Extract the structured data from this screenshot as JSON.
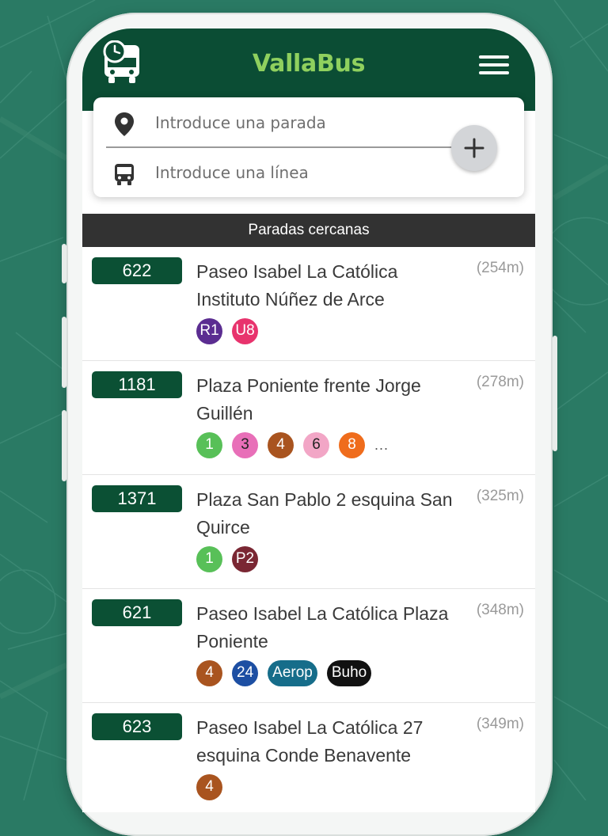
{
  "app": {
    "title": "VallaBus",
    "logo_icon": "bus-clock-icon",
    "menu_icon": "hamburger-menu-icon"
  },
  "search": {
    "stop_placeholder": "Introduce una parada",
    "stop_icon": "location-pin-icon",
    "line_placeholder": "Introduce una línea",
    "line_icon": "bus-icon",
    "add_icon": "plus-icon"
  },
  "nearby": {
    "header": "Paradas cercanas",
    "stops": [
      {
        "code": "622",
        "name": "Paseo Isabel La Católica Instituto Núñez de Arce",
        "distance": "(254m)",
        "lines": [
          {
            "label": "R1",
            "bg": "#5b2d91",
            "fg": "#ffffff"
          },
          {
            "label": "U8",
            "bg": "#e8336d",
            "fg": "#ffffff"
          }
        ],
        "more": ""
      },
      {
        "code": "1181",
        "name": "Plaza Poniente frente Jorge Guillén",
        "distance": "(278m)",
        "lines": [
          {
            "label": "1",
            "bg": "#58c058",
            "fg": "#ffffff"
          },
          {
            "label": "3",
            "bg": "#e86fb8",
            "fg": "#222222"
          },
          {
            "label": "4",
            "bg": "#a9541f",
            "fg": "#ffffff"
          },
          {
            "label": "6",
            "bg": "#f2a6c6",
            "fg": "#222222"
          },
          {
            "label": "8",
            "bg": "#ef6c1c",
            "fg": "#ffffff"
          }
        ],
        "more": "..."
      },
      {
        "code": "1371",
        "name": "Plaza San Pablo 2 esquina San Quirce",
        "distance": "(325m)",
        "lines": [
          {
            "label": "1",
            "bg": "#58c058",
            "fg": "#ffffff"
          },
          {
            "label": "P2",
            "bg": "#7a2733",
            "fg": "#ffffff"
          }
        ],
        "more": ""
      },
      {
        "code": "621",
        "name": "Paseo Isabel La Católica Plaza Poniente",
        "distance": "(348m)",
        "lines": [
          {
            "label": "4",
            "bg": "#a9541f",
            "fg": "#ffffff"
          },
          {
            "label": "24",
            "bg": "#1d4fa3",
            "fg": "#ffffff"
          },
          {
            "label": "Aerop",
            "bg": "#166d8a",
            "fg": "#ffffff"
          },
          {
            "label": "Buho",
            "bg": "#111111",
            "fg": "#ffffff"
          }
        ],
        "more": ""
      },
      {
        "code": "623",
        "name": "Paseo Isabel La Católica 27 esquina Conde Benavente",
        "distance": "(349m)",
        "lines": [
          {
            "label": "4",
            "bg": "#a9541f",
            "fg": "#ffffff"
          }
        ],
        "more": ""
      }
    ]
  },
  "colors": {
    "background": "#2a7a64",
    "header": "#0b4d34",
    "title": "#8fd05e",
    "stop_code_bg": "#0b5034",
    "section_header": "#323232"
  }
}
